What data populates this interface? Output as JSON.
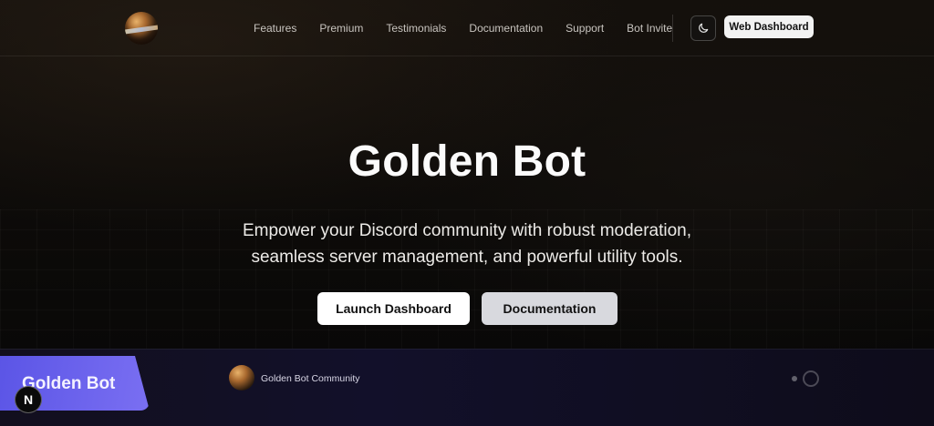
{
  "header": {
    "nav": [
      "Features",
      "Premium",
      "Testimonials",
      "Documentation",
      "Support",
      "Bot Invite"
    ],
    "theme_toggle_icon": "moon-icon",
    "web_dashboard_label": "Web Dashboard"
  },
  "hero": {
    "title": "Golden Bot",
    "subtitle_line1": "Empower your Discord community with robust moderation,",
    "subtitle_line2": "seamless server management, and powerful utility tools.",
    "launch_label": "Launch Dashboard",
    "docs_label": "Documentation"
  },
  "preview": {
    "card_label": "Golden Bot",
    "community_label": "Golden Bot Community",
    "badge_letter": "N"
  },
  "colors": {
    "background": "#0b0908",
    "accent_purple": "#5b55e6",
    "button_primary": "#ffffff",
    "button_secondary": "#d8d9de"
  }
}
